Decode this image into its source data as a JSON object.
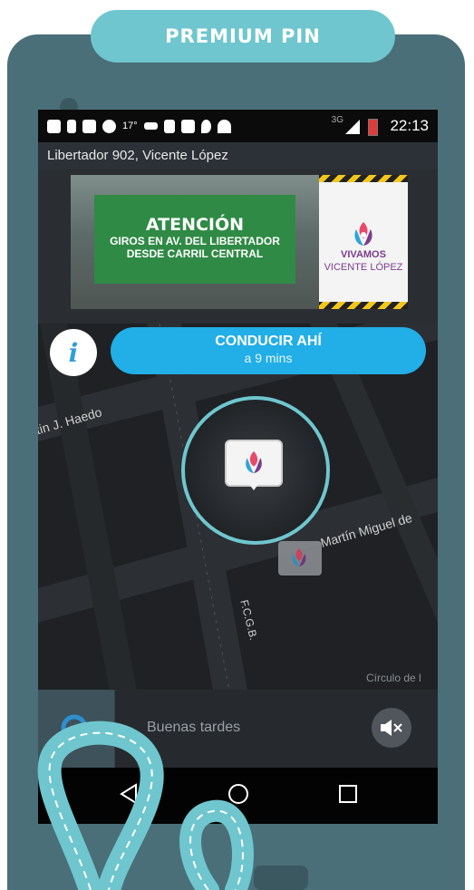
{
  "app": {
    "header_label": "PREMIUM PIN"
  },
  "status_bar": {
    "temp": "17°",
    "network": "3G",
    "time": "22:13",
    "icons": [
      "skype-icon",
      "alert-icon",
      "image-icon",
      "whatsapp-icon",
      "voicemail-icon",
      "play-store-icon",
      "message-icon",
      "location-icon",
      "wifi-icon",
      "signal-icon",
      "battery-icon"
    ]
  },
  "address": "Libertador 902, Vicente López",
  "banner": {
    "title": "ATENCIÓN",
    "line1": "GIROS EN AV. DEL LIBERTADOR",
    "line2": "DESDE CARRIL CENTRAL",
    "brand_line1": "VIVAMOS",
    "brand_line2": "VICENTE LÓPEZ"
  },
  "actions": {
    "info_label": "i",
    "drive_label": "CONDUCIR AHÍ",
    "drive_eta": "a 9 mins"
  },
  "map": {
    "streets": [
      "rtin J. Haedo",
      "Martín Miguel de",
      "F.C.G.B.",
      "Círculo de l"
    ]
  },
  "bottom_bar": {
    "greeting": "Buenas tardes"
  },
  "nav": {
    "back": "back-icon",
    "home": "home-icon",
    "recents": "recents-icon"
  },
  "colors": {
    "accent": "#6fc6ce",
    "drive": "#22aee6",
    "phone": "#4a6f79"
  }
}
